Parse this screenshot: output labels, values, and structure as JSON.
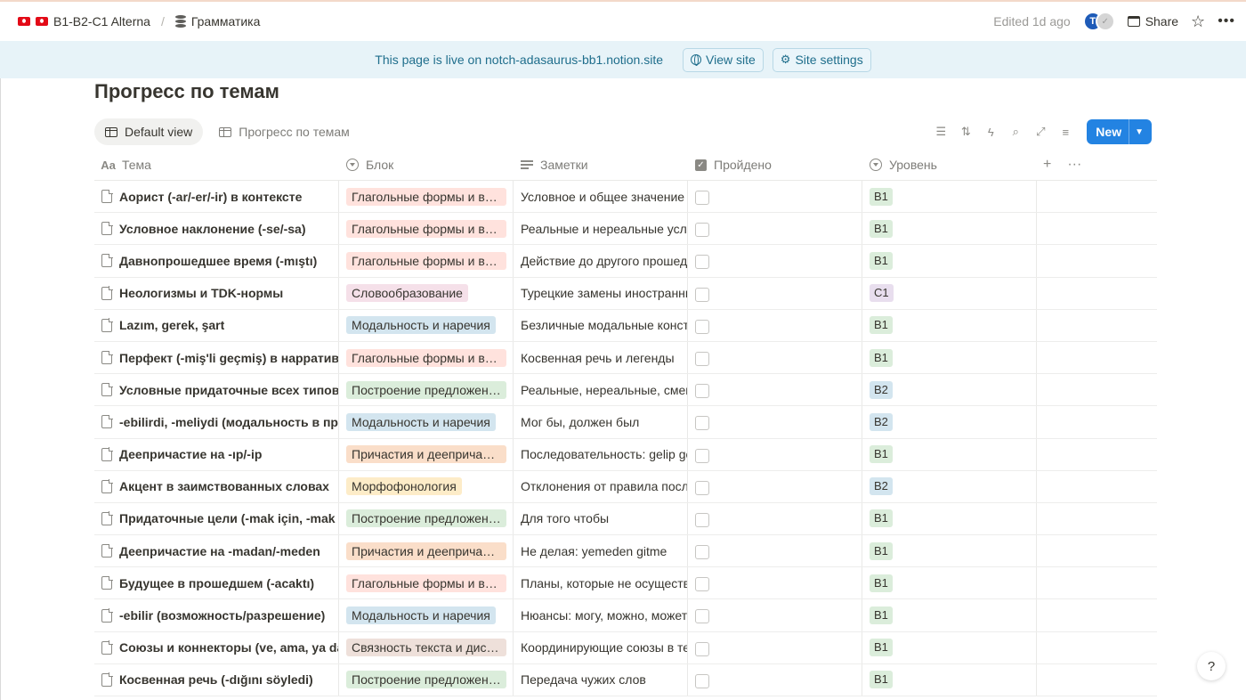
{
  "breadcrumb": {
    "workspace": "B1-B2-C1 Alterna",
    "page": "Грамматика"
  },
  "header": {
    "edited": "Edited 1d ago",
    "avatar_initial": "T",
    "share_label": "Share"
  },
  "banner": {
    "text": "This page is live on notch-adasaurus-bb1.notion.site",
    "view_site": "View site",
    "site_settings": "Site settings"
  },
  "title": "Прогресс по темам",
  "views": [
    {
      "label": "Default view",
      "active": true
    },
    {
      "label": "Прогресс по темам",
      "active": false
    }
  ],
  "toolbar": {
    "new_label": "New"
  },
  "columns": {
    "name": "Тема",
    "block": "Блок",
    "notes": "Заметки",
    "done": "Пройдено",
    "level": "Уровень"
  },
  "colors": {
    "accent": "#2383e2",
    "banner_bg": "#e7f3f8",
    "tag_red": "#ffe2dd",
    "tag_pink": "#f5e0e9",
    "tag_blue": "#d3e5ef",
    "tag_green": "#dbeddb",
    "tag_orange": "#fadec9",
    "tag_yellow": "#fdecc8",
    "tag_brown": "#eee0da",
    "tag_purple": "#e8deee"
  },
  "rows": [
    {
      "name": "Аорист (-ar/-er/-ir) в контексте",
      "block": "Глагольные формы и времена",
      "block_color": "red",
      "notes": "Условное и общее значение аориста",
      "done": false,
      "level": "B1",
      "level_color": "green"
    },
    {
      "name": "Условное наклонение (-se/-sa)",
      "block": "Глагольные формы и времена",
      "block_color": "red",
      "notes": "Реальные и нереальные условия",
      "done": false,
      "level": "B1",
      "level_color": "green"
    },
    {
      "name": "Давнопрошедшее время (-mıştı)",
      "block": "Глагольные формы и времена",
      "block_color": "red",
      "notes": "Действие до другого прошедшего",
      "done": false,
      "level": "B1",
      "level_color": "green"
    },
    {
      "name": "Неологизмы и TDK-нормы",
      "block": "Словообразование",
      "block_color": "pink",
      "notes": "Турецкие замены иностранных слов",
      "done": false,
      "level": "C1",
      "level_color": "purple"
    },
    {
      "name": "Lazım, gerek, şart",
      "block": "Модальность и наречия",
      "block_color": "blue",
      "notes": "Безличные модальные конструкции",
      "done": false,
      "level": "B1",
      "level_color": "green"
    },
    {
      "name": "Перфект (-miş'li geçmiş) в нарративе",
      "block": "Глагольные формы и времена",
      "block_color": "red",
      "notes": "Косвенная речь и легенды",
      "done": false,
      "level": "B1",
      "level_color": "green"
    },
    {
      "name": "Условные придаточные всех типов",
      "block": "Построение предложений",
      "block_color": "green",
      "notes": "Реальные, нереальные, смешанные",
      "done": false,
      "level": "B2",
      "level_color": "blue"
    },
    {
      "name": "-ebilirdi, -meliydi (модальность в прошлом)",
      "block": "Модальность и наречия",
      "block_color": "blue",
      "notes": "Мог бы, должен был",
      "done": false,
      "level": "B2",
      "level_color": "blue"
    },
    {
      "name": "Деепричастие на -ıp/-ip",
      "block": "Причастия и деепричастия",
      "block_color": "orange",
      "notes": "Последовательность: gelip gördü",
      "done": false,
      "level": "B1",
      "level_color": "green"
    },
    {
      "name": "Акцент в заимствованных словах",
      "block": "Морфофонология",
      "block_color": "yellow",
      "notes": "Отклонения от правила последнего слога",
      "done": false,
      "level": "B2",
      "level_color": "blue"
    },
    {
      "name": "Придаточные цели (-mak için, -mak amacıyla)",
      "block": "Построение предложений",
      "block_color": "green",
      "notes": "Для того чтобы",
      "done": false,
      "level": "B1",
      "level_color": "green"
    },
    {
      "name": "Деепричастие на -madan/-meden",
      "block": "Причастия и деепричастия",
      "block_color": "orange",
      "notes": "Не делая: yemeden gitme",
      "done": false,
      "level": "B1",
      "level_color": "green"
    },
    {
      "name": "Будущее в прошедшем (-acaktı)",
      "block": "Глагольные формы и времена",
      "block_color": "red",
      "notes": "Планы, которые не осуществились",
      "done": false,
      "level": "B1",
      "level_color": "green"
    },
    {
      "name": "-ebilir (возможность/разрешение)",
      "block": "Модальность и наречия",
      "block_color": "blue",
      "notes": "Нюансы: могу, можно, может быть",
      "done": false,
      "level": "B1",
      "level_color": "green"
    },
    {
      "name": "Союзы и коннекторы (ve, ama, ya da, hem)",
      "block": "Связность текста и дискурс",
      "block_color": "brown",
      "notes": "Координирующие союзы в тексте",
      "done": false,
      "level": "B1",
      "level_color": "green"
    },
    {
      "name": "Косвенная речь (-dığını söyledi)",
      "block": "Построение предложений",
      "block_color": "green",
      "notes": "Передача чужих слов",
      "done": false,
      "level": "B1",
      "level_color": "green"
    }
  ]
}
